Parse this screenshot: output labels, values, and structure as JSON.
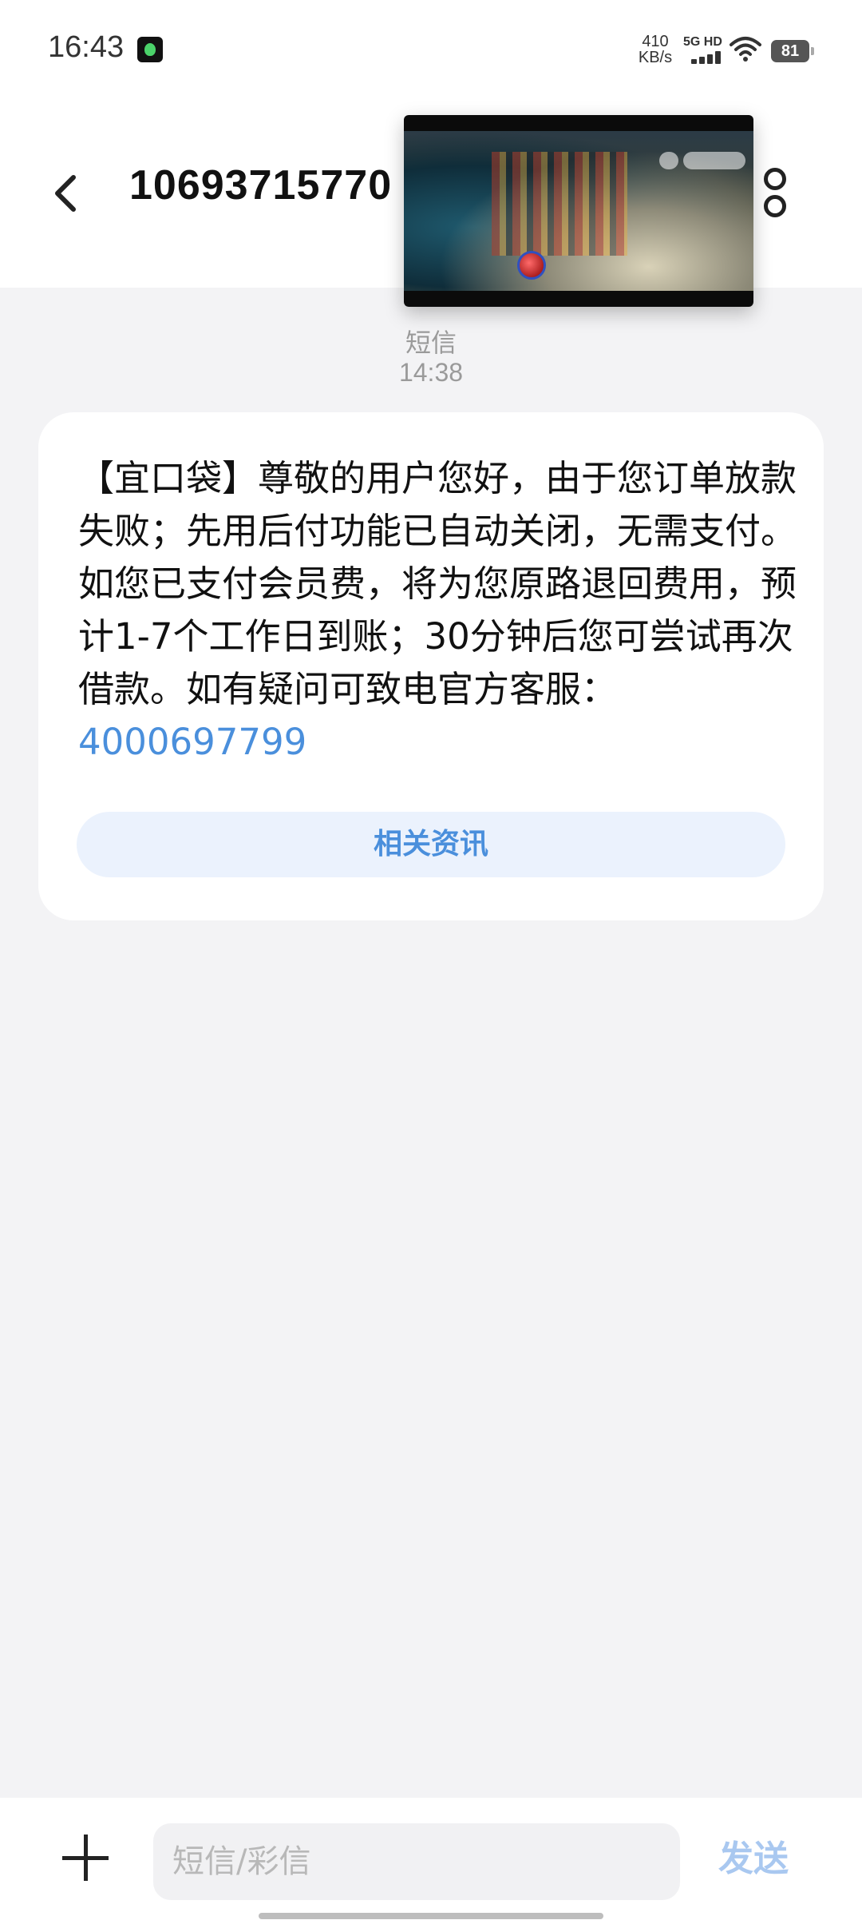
{
  "status_bar": {
    "time": "16:43",
    "net_speed_value": "410",
    "net_speed_unit": "KB/s",
    "network_type": "5G HD",
    "battery": "81",
    "icons": [
      "app-notification-icon",
      "signal-icon",
      "wifi-icon",
      "battery-icon"
    ]
  },
  "header": {
    "title": "10693715770",
    "back_icon": "chevron-left-icon",
    "more_icon": "more-icon"
  },
  "thread": {
    "channel_label": "短信",
    "timestamp": "14:38"
  },
  "message": {
    "text": "【宜口袋】尊敬的用户您好，由于您订单放款失败；先用后付功能已自动关闭，无需支付。如您已支付会员费，将为您原路退回费用，预计1-7个工作日到账；30分钟后您可尝试再次借款。如有疑问可致电官方客服：",
    "phone": "4000697799",
    "related_button": "相关资讯"
  },
  "composer": {
    "placeholder": "短信/彩信",
    "send_label": "发送",
    "add_icon": "plus-icon"
  },
  "colors": {
    "link": "#4a8fdc",
    "send_disabled": "#a9c8f0",
    "background": "#f3f3f5"
  }
}
